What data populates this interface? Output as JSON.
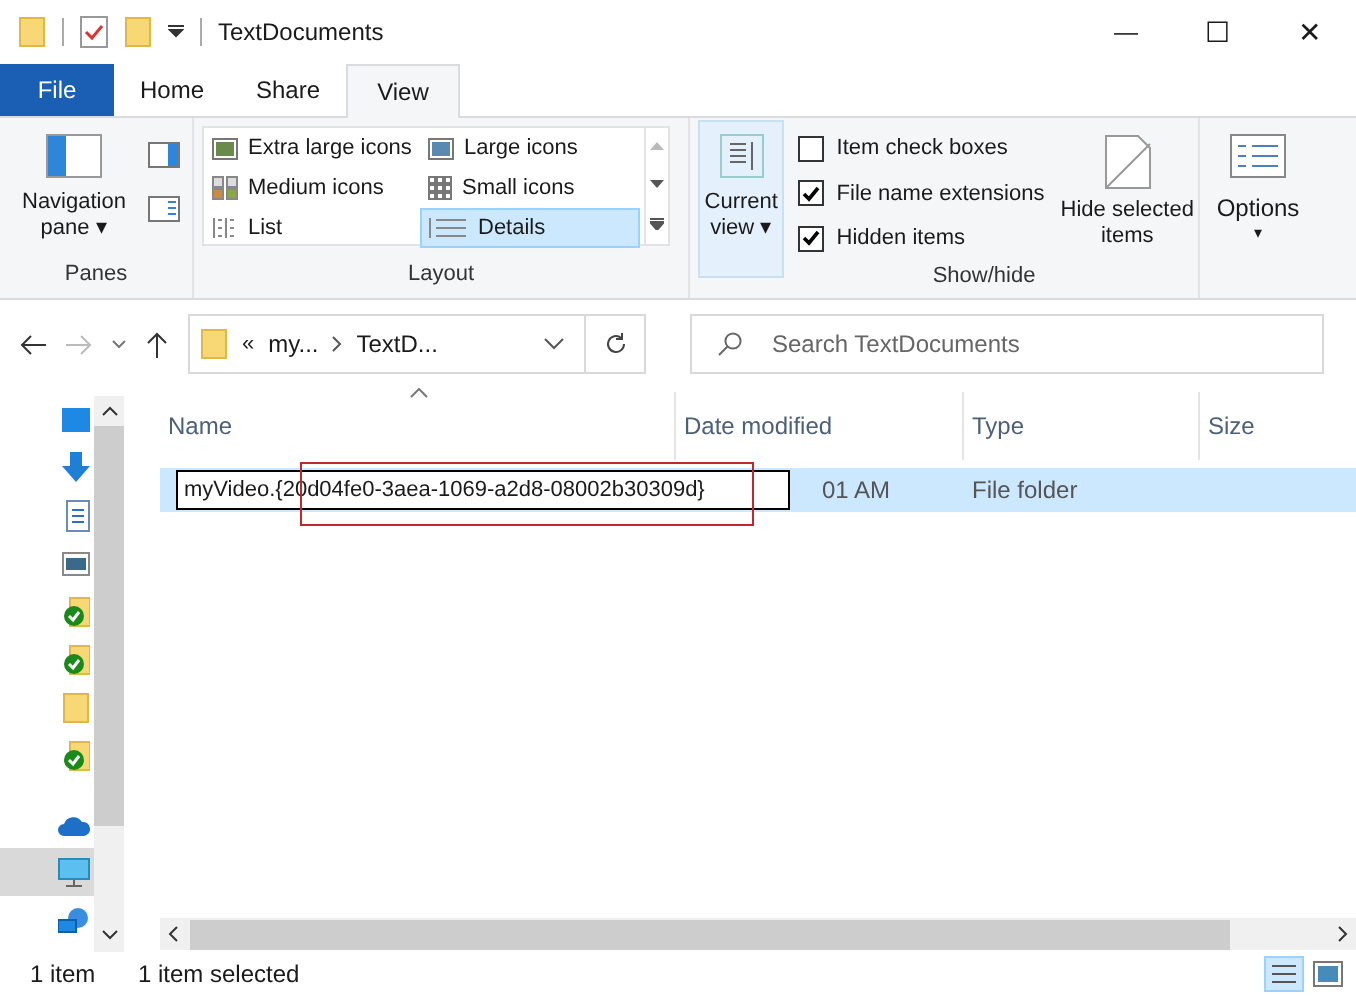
{
  "window": {
    "title": "TextDocuments",
    "controls": {
      "minimize": "—",
      "maximize": "☐",
      "close": "✕"
    }
  },
  "tabs": [
    {
      "label": "File",
      "kind": "file",
      "selected": false
    },
    {
      "label": "Home",
      "kind": "tab",
      "selected": false
    },
    {
      "label": "Share",
      "kind": "tab",
      "selected": false
    },
    {
      "label": "View",
      "kind": "tab",
      "selected": true
    }
  ],
  "ribbon": {
    "panes": {
      "navigation_pane": "Navigation pane",
      "navigation_pane_caret": "▾",
      "caption": "Panes"
    },
    "layout": {
      "caption": "Layout",
      "options": [
        {
          "label": "Extra large icons",
          "kind": "xl",
          "selected": false
        },
        {
          "label": "Large icons",
          "kind": "large",
          "selected": false
        },
        {
          "label": "Medium icons",
          "kind": "medium",
          "selected": false
        },
        {
          "label": "Small icons",
          "kind": "small",
          "selected": false
        },
        {
          "label": "List",
          "kind": "list",
          "selected": false
        },
        {
          "label": "Details",
          "kind": "details",
          "selected": true
        }
      ]
    },
    "current_view": "Current view",
    "current_view_caret": "▾",
    "show_hide": {
      "caption": "Show/hide",
      "checkboxes": [
        {
          "label": "Item check boxes",
          "checked": false
        },
        {
          "label": "File name extensions",
          "checked": true
        },
        {
          "label": "Hidden items",
          "checked": true
        }
      ],
      "hide_selected": "Hide selected items"
    },
    "options": "Options",
    "options_caret": "▾"
  },
  "address": {
    "overflow": "«",
    "crumbs": [
      "my...",
      "TextD..."
    ],
    "search_placeholder": "Search TextDocuments"
  },
  "nav_items": [
    {
      "kind": "desktop",
      "selected": false
    },
    {
      "kind": "downloads",
      "selected": false
    },
    {
      "kind": "documents",
      "selected": false
    },
    {
      "kind": "pictures",
      "selected": false
    },
    {
      "kind": "synced",
      "selected": false
    },
    {
      "kind": "synced",
      "selected": false
    },
    {
      "kind": "folder",
      "selected": false
    },
    {
      "kind": "synced",
      "selected": false
    },
    {
      "kind": "cloud",
      "selected": false
    },
    {
      "kind": "computer",
      "selected": true
    },
    {
      "kind": "network",
      "selected": false
    }
  ],
  "table": {
    "columns": [
      "Name",
      "Date modified",
      "Type",
      "Size"
    ],
    "rows": [
      {
        "name": "myVideo.{20d04fe0-3aea-1069-a2d8-08002b30309d}",
        "date": "01 AM",
        "type": "File folder",
        "selected": true,
        "editing": true
      }
    ]
  },
  "status_bar": {
    "count": "1 item",
    "selection": "1 item selected"
  }
}
